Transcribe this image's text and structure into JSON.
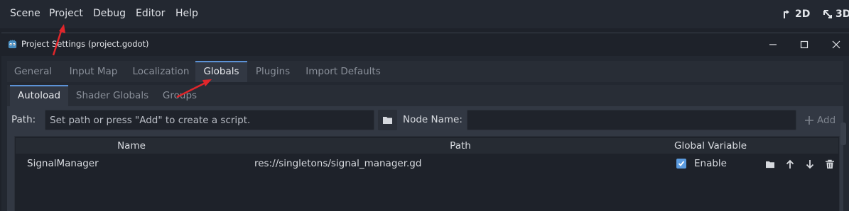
{
  "menubar": {
    "items": [
      "Scene",
      "Project",
      "Debug",
      "Editor",
      "Help"
    ],
    "mode_2d": "2D",
    "mode_3d": "3D"
  },
  "dialog": {
    "title": "Project Settings (project.godot)",
    "tabs": [
      "General",
      "Input Map",
      "Localization",
      "Globals",
      "Plugins",
      "Import Defaults"
    ],
    "active_tab": "Globals",
    "subtabs": [
      "Autoload",
      "Shader Globals",
      "Groups"
    ],
    "active_subtab": "Autoload"
  },
  "autoload": {
    "path_label": "Path:",
    "path_placeholder": "Set path or press \"Add\" to create a script.",
    "node_name_label": "Node Name:",
    "node_name_value": "",
    "add_label": "Add",
    "columns": [
      "Name",
      "Path",
      "Global Variable"
    ],
    "rows": [
      {
        "name": "SignalManager",
        "path": "res://singletons/signal_manager.gd",
        "global_variable": "Enable",
        "enabled": true
      }
    ]
  },
  "colors": {
    "accent": "#5c92d6",
    "annotation_arrow": "#e0262b",
    "checkbox": "#5b9bdf"
  }
}
